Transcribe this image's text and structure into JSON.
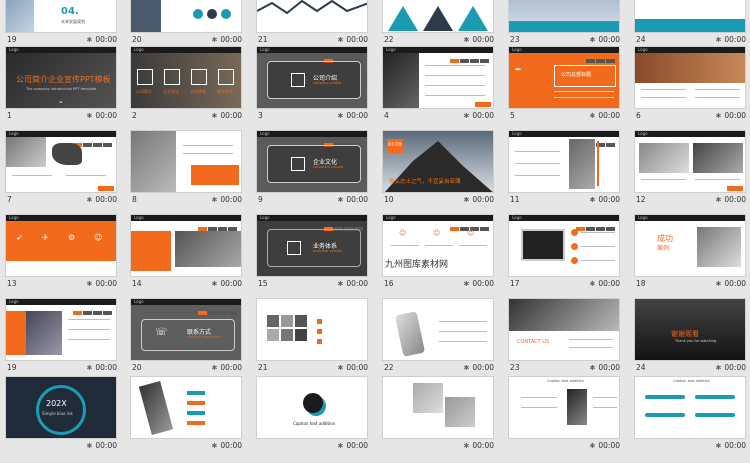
{
  "colors": {
    "accent": "#f26b1d",
    "dark": "#2b2b2b",
    "teal": "#1b9bb3"
  },
  "watermark": "九州图库素材网",
  "icons": {
    "star": "star-icon"
  },
  "row0": [
    {
      "num": "19",
      "time": "00:00",
      "text": "04.",
      "sub": "未来发展规划"
    },
    {
      "num": "20",
      "time": "00:00"
    },
    {
      "num": "21",
      "time": "00:00"
    },
    {
      "num": "22",
      "time": "00:00"
    },
    {
      "num": "23",
      "time": "00:00"
    },
    {
      "num": "24",
      "time": "00:00"
    }
  ],
  "slides": [
    {
      "num": "1",
      "time": "00:00",
      "title": "公司简介企业宣传PPT模板",
      "sub": "The company introduction PPT template"
    },
    {
      "num": "2",
      "time": "00:00",
      "labels": [
        "公司简介",
        "企业文化",
        "业务体系",
        "联系方式"
      ]
    },
    {
      "num": "3",
      "time": "00:00",
      "title": "公司介绍",
      "sub": "company profile"
    },
    {
      "num": "4",
      "time": "00:00"
    },
    {
      "num": "5",
      "time": "00:00",
      "title": "公司总部标题"
    },
    {
      "num": "6",
      "time": "00:00"
    },
    {
      "num": "7",
      "time": "00:00"
    },
    {
      "num": "8",
      "time": "00:00"
    },
    {
      "num": "9",
      "time": "00:00",
      "title": "企业文化",
      "sub": "corporate culture"
    },
    {
      "num": "10",
      "time": "00:00",
      "title": "恢弘志士之气，不宜妄自菲薄",
      "tag": "企业文化"
    },
    {
      "num": "11",
      "time": "00:00"
    },
    {
      "num": "12",
      "time": "00:00"
    },
    {
      "num": "13",
      "time": "00:00"
    },
    {
      "num": "14",
      "time": "00:00"
    },
    {
      "num": "15",
      "time": "00:00",
      "title": "业务体系",
      "sub": "business system"
    },
    {
      "num": "16",
      "time": "00:00"
    },
    {
      "num": "17",
      "time": "00:00"
    },
    {
      "num": "18",
      "time": "00:00",
      "title": "成功",
      "sub": "案例"
    },
    {
      "num": "19",
      "time": "00:00"
    },
    {
      "num": "20",
      "time": "00:00",
      "title": "联系方式",
      "sub": "contact information"
    },
    {
      "num": "21",
      "time": "00:00"
    },
    {
      "num": "22",
      "time": "00:00"
    },
    {
      "num": "23",
      "time": "00:00",
      "title": "CONTACT US"
    },
    {
      "num": "24",
      "time": "00:00",
      "title": "谢谢观看",
      "sub": "Thank you for watching"
    },
    {
      "num": "",
      "time": "00:00",
      "title": "202X",
      "sub": "Simple blue ink"
    },
    {
      "num": "",
      "time": "00:00"
    },
    {
      "num": "",
      "time": "00:00",
      "title": "Caption text addition"
    },
    {
      "num": "",
      "time": "00:00"
    },
    {
      "num": "",
      "time": "00:00",
      "title": "Caption text addition"
    },
    {
      "num": "",
      "time": "00:00",
      "title": "Caption text addition"
    }
  ]
}
